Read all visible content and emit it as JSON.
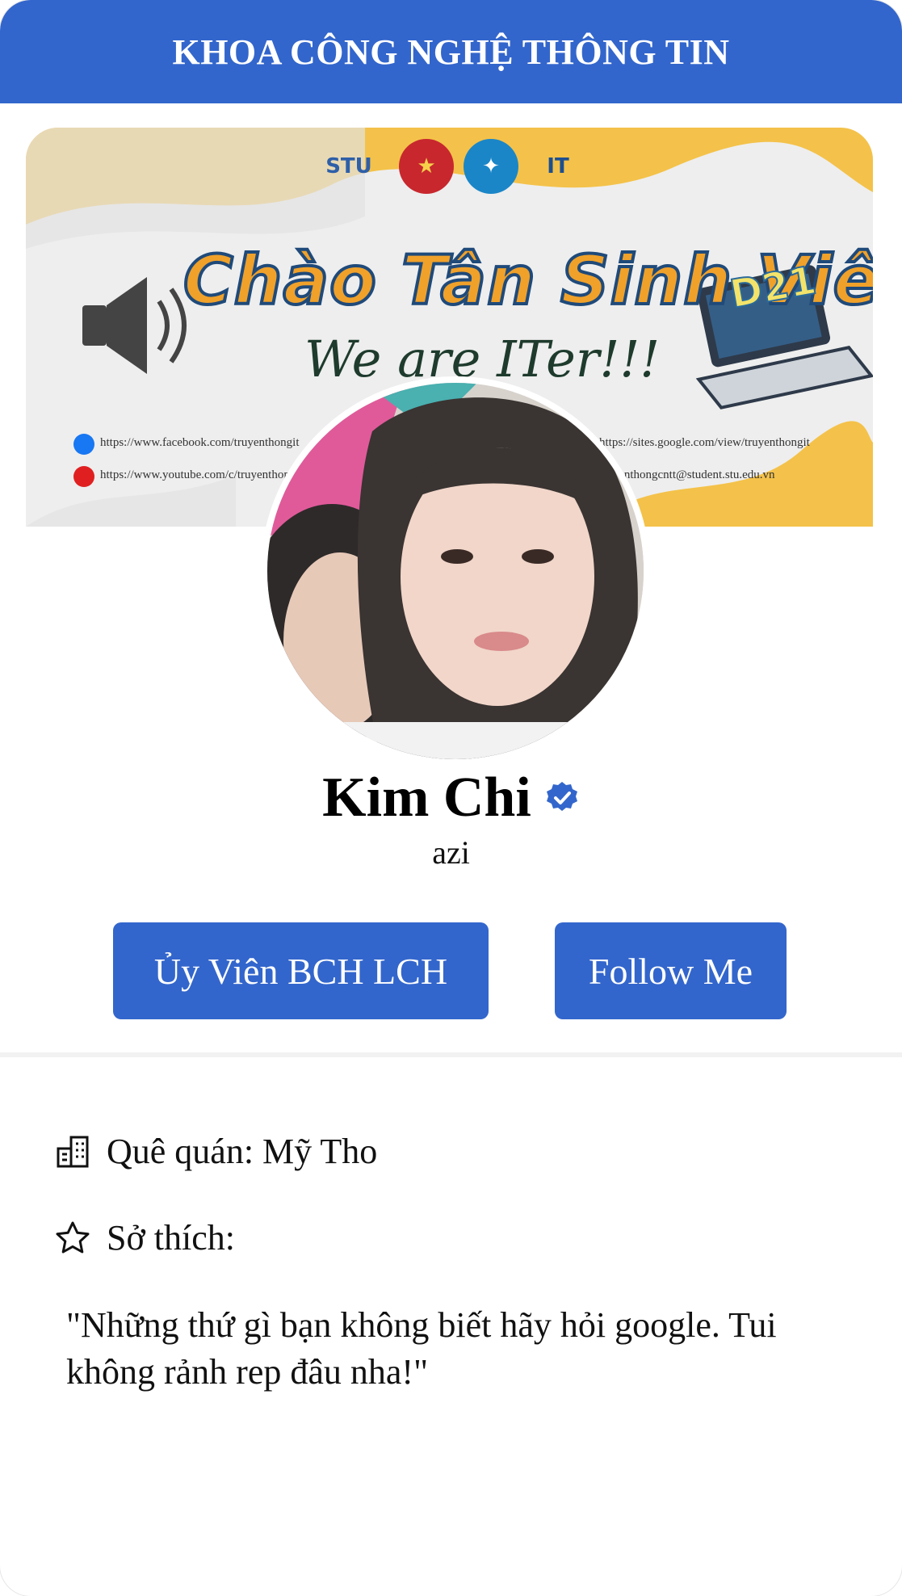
{
  "header": {
    "title": "KHOA CÔNG NGHỆ THÔNG TIN"
  },
  "banner": {
    "title": "Chào Tân Sinh Viên",
    "subtitle": "We are ITer!!!",
    "badge": "D21",
    "logos": [
      "STU",
      "IT"
    ],
    "links": [
      "https://www.facebook.com/truyenthongit",
      "https://www.youtube.com/c/truyenthongit",
      "https://sites.google.com/view/truyenthongit",
      "truyenthongcntt@student.stu.edu.vn"
    ]
  },
  "profile": {
    "name": "Kim Chi",
    "handle": "azi",
    "verified": true
  },
  "buttons": {
    "role_label": "Ủy Viên BCH LCH",
    "follow_label": "Follow Me"
  },
  "info": {
    "hometown": "Quê quán: Mỹ Tho",
    "hobbies": "Sở thích:",
    "quote": "\"Những thứ gì bạn không biết hãy hỏi google. Tui không rảnh rep đâu nha!\""
  },
  "colors": {
    "accent": "#3366cc",
    "banner_yellow": "#f0a12a"
  },
  "icons": {
    "hometown": "building-icon",
    "hobbies": "star-icon",
    "verified": "verified-badge-icon"
  }
}
